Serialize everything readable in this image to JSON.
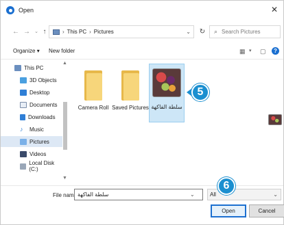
{
  "window": {
    "title": "Open"
  },
  "navigation": {
    "breadcrumb": [
      "This PC",
      "Pictures"
    ],
    "search_placeholder": "Search Pictures"
  },
  "toolbar": {
    "organize_label": "Organize",
    "new_folder_label": "New folder"
  },
  "nav_pane": {
    "items": [
      {
        "label": "This PC",
        "icon": "computer-icon"
      },
      {
        "label": "3D Objects",
        "icon": "cube-icon"
      },
      {
        "label": "Desktop",
        "icon": "desktop-icon"
      },
      {
        "label": "Documents",
        "icon": "document-icon"
      },
      {
        "label": "Downloads",
        "icon": "download-icon"
      },
      {
        "label": "Music",
        "icon": "music-icon"
      },
      {
        "label": "Pictures",
        "icon": "pictures-icon",
        "selected": true
      },
      {
        "label": "Videos",
        "icon": "video-icon"
      },
      {
        "label": "Local Disk (C:)",
        "icon": "disk-icon"
      }
    ]
  },
  "files": [
    {
      "label": "Camera Roll",
      "type": "folder"
    },
    {
      "label": "Saved Pictures",
      "type": "folder"
    },
    {
      "label": "سلطة الفاكهة",
      "type": "image",
      "selected": true
    }
  ],
  "callouts": {
    "step5": "5",
    "step6": "6"
  },
  "bottom": {
    "file_name_label": "File name:",
    "file_name_value": "سلطة الفاكهة",
    "file_type_value": "All",
    "open_label": "Open",
    "cancel_label": "Cancel"
  },
  "colors": {
    "accent": "#1b8fd0",
    "selection": "#cde6f7",
    "folder": "#f7d67b"
  }
}
